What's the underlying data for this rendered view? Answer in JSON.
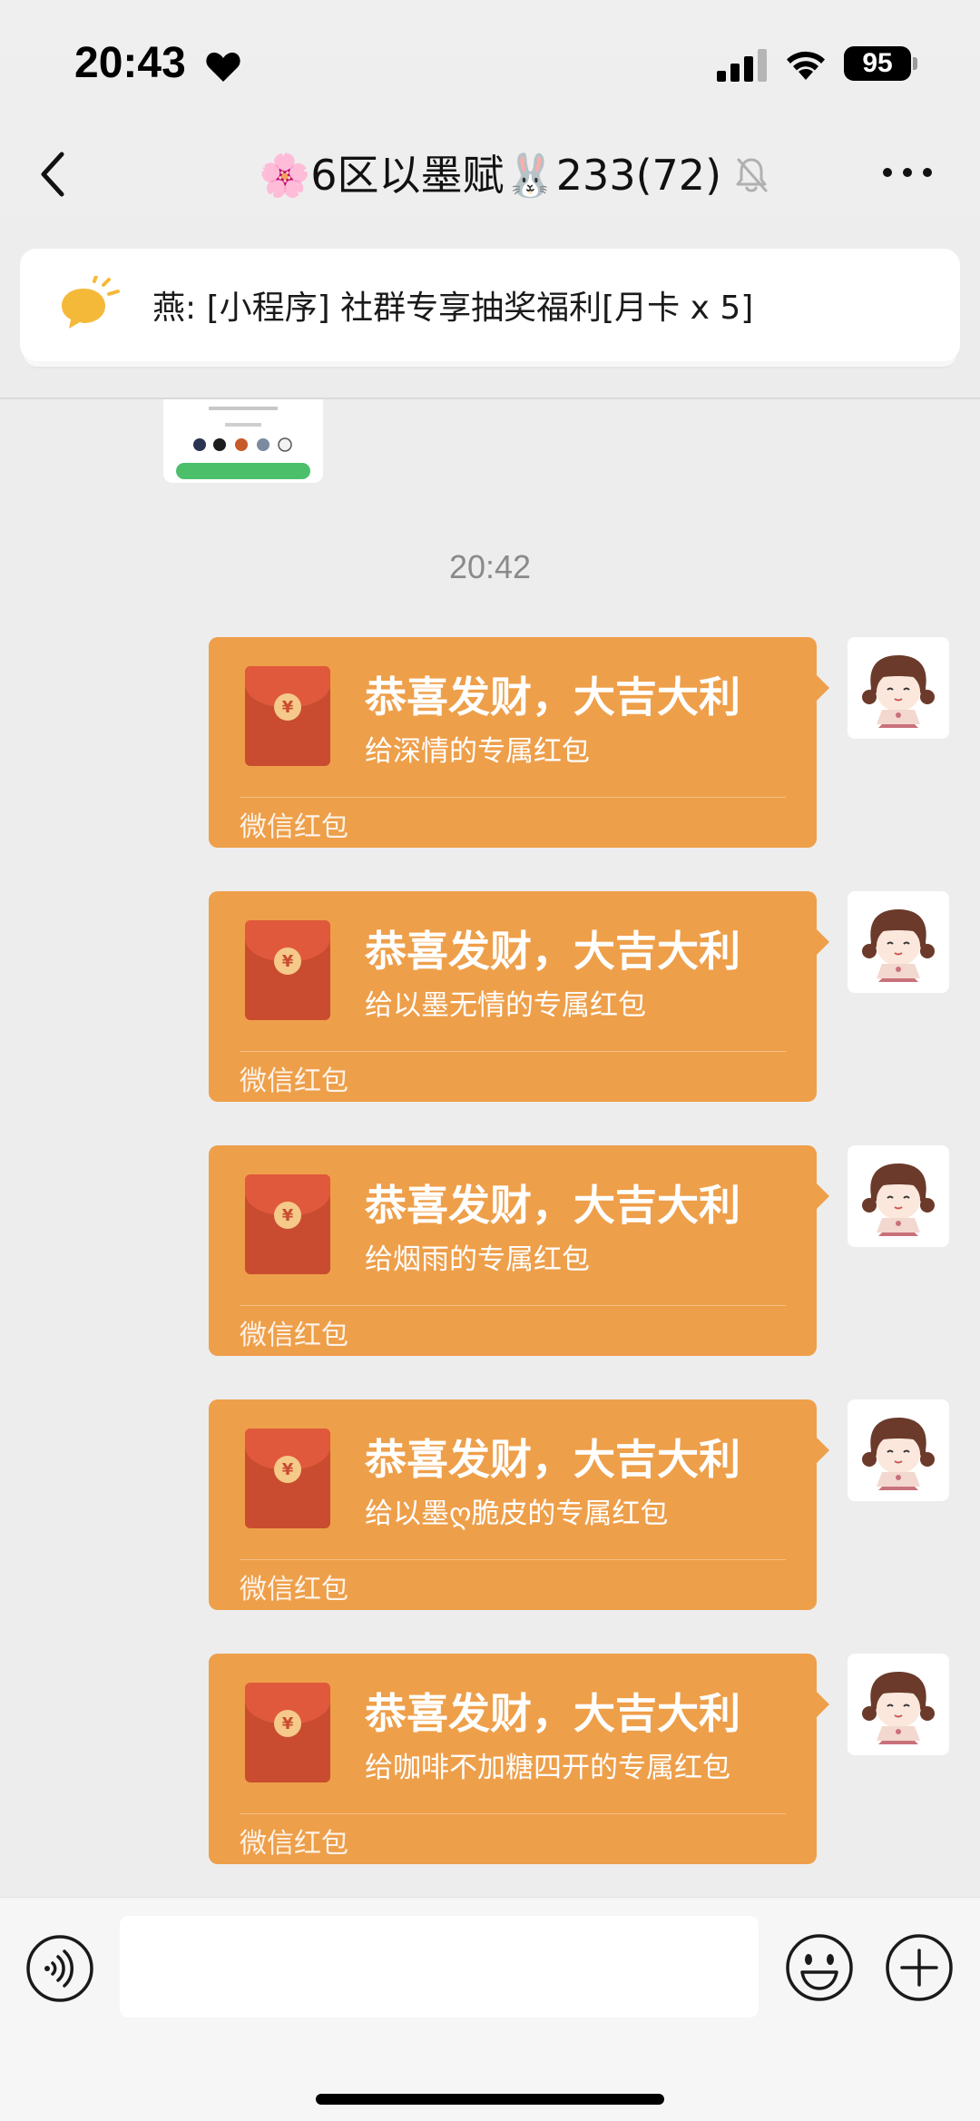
{
  "status_bar": {
    "time": "20:43",
    "battery": "95"
  },
  "nav": {
    "title": "🌸6区以墨赋🐰233(72)"
  },
  "pinned": {
    "text": "燕: [小程序] 社群专享抽奖福利[月卡 x 5]"
  },
  "timestamp": "20:42",
  "messages": [
    {
      "title": "恭喜发财，大吉大利",
      "subtitle": "给深情的专属红包",
      "footer": "微信红包"
    },
    {
      "title": "恭喜发财，大吉大利",
      "subtitle": "给以墨无情的专属红包",
      "footer": "微信红包"
    },
    {
      "title": "恭喜发财，大吉大利",
      "subtitle": "给烟雨的专属红包",
      "footer": "微信红包"
    },
    {
      "title": "恭喜发财，大吉大利",
      "subtitle": "给以墨ღ脆皮的专属红包",
      "footer": "微信红包"
    },
    {
      "title": "恭喜发财，大吉大利",
      "subtitle": "给咖啡不加糖四开的专属红包",
      "footer": "微信红包"
    }
  ],
  "packet_coin": "¥",
  "colors": {
    "packet_bg": "#ee9f4a",
    "packet_icon": "#c94c30",
    "mini_button": "#4cbf6b"
  },
  "icons": {
    "heart": "heart-icon",
    "signal": "signal-icon",
    "wifi": "wifi-icon",
    "back": "chevron-left-icon",
    "mute": "bell-slash-icon",
    "more": "more-dots-icon",
    "pinned": "speech-bubble-icon",
    "voice": "voice-icon",
    "emoji": "emoji-icon",
    "plus": "plus-icon"
  }
}
